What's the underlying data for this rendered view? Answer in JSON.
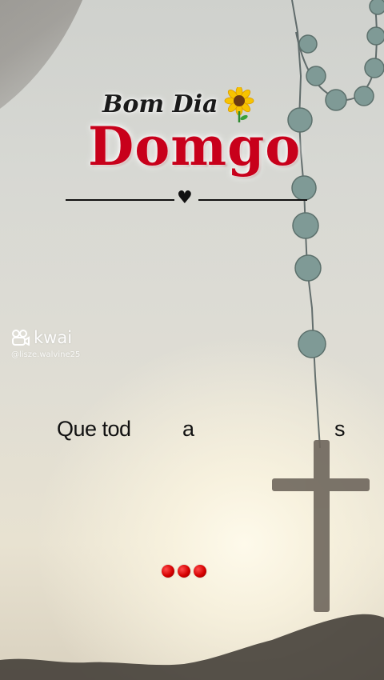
{
  "title": {
    "greeting": "Bom Dia",
    "day": "Domgo"
  },
  "watermark": {
    "brand": "kwai",
    "handle": "@lisze.walvine25"
  },
  "caption": {
    "part1": "Que tod",
    "part2": "a",
    "part3": "s"
  },
  "icons": {
    "sunflower": "sunflower-icon",
    "heart": "heart-icon",
    "kwai": "kwai-logo-icon"
  },
  "colors": {
    "title_red": "#c8001b",
    "dots_red": "#d40000"
  },
  "symbols": {
    "heart": "♥"
  }
}
